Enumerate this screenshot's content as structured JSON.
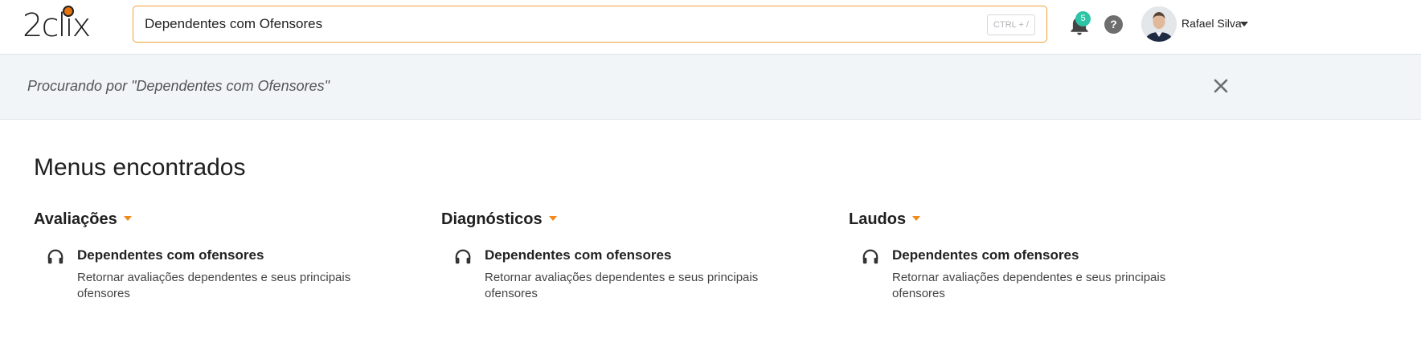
{
  "header": {
    "logo_text": "2clix",
    "search_value": "Dependentes com Ofensores",
    "search_shortcut": "CTRL + /",
    "notification_count": "5",
    "help_label": "?",
    "user_name": "Rafael Silva"
  },
  "banner": {
    "text": "Procurando por \"Dependentes com Ofensores\""
  },
  "main": {
    "section_title": "Menus encontrados",
    "columns": [
      {
        "title": "Avaliações",
        "item_title": "Dependentes com ofensores",
        "item_desc": "Retornar avaliações dependentes e seus principais ofensores"
      },
      {
        "title": "Diagnósticos",
        "item_title": "Dependentes com ofensores",
        "item_desc": "Retornar avaliações dependentes e seus principais ofensores"
      },
      {
        "title": "Laudos",
        "item_title": "Dependentes com ofensores",
        "item_desc": "Retornar avaliações dependentes e seus principais ofensores"
      }
    ]
  },
  "colors": {
    "accent": "#f08a1a",
    "badge": "#2ec4a6",
    "banner_bg": "#f1f5f8"
  },
  "icons": {
    "item_icon": "headphones-icon",
    "close_icon": "close-icon",
    "bell_icon": "bell-icon",
    "help_icon": "help-icon"
  }
}
